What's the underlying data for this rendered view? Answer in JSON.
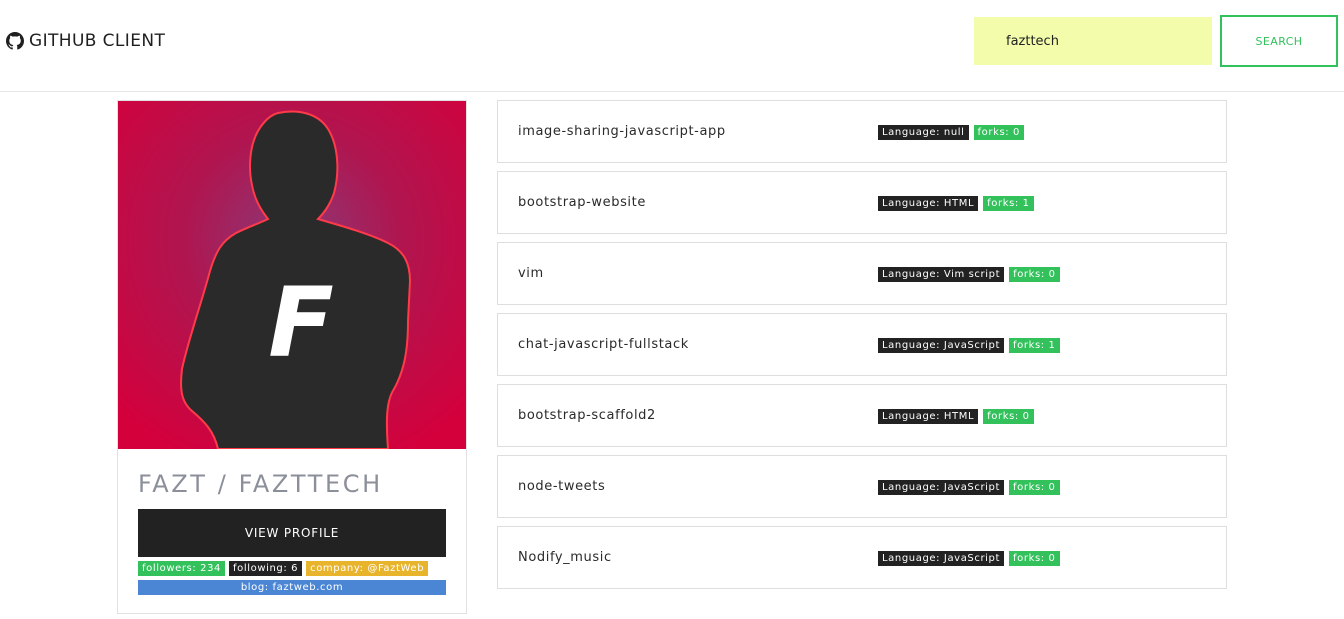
{
  "navbar": {
    "brand_icon": "github-icon",
    "brand_text": "GITHUB CLIENT",
    "search_value": "fazttech",
    "search_button": "SEARCH"
  },
  "colors": {
    "accent_green": "#33c15c",
    "dark": "#222222",
    "yellow": "#e8b42c",
    "blue": "#4a86d4",
    "search_bg": "#f2fcaa",
    "avatar_bg": "#d4003c"
  },
  "profile": {
    "avatar_letter": "F",
    "name": "FAZT / FAZTTECH",
    "view_profile": "VIEW PROFILE",
    "followers": "followers: 234",
    "following": "following: 6",
    "company": "company: @FaztWeb",
    "blog": "blog: faztweb.com"
  },
  "repos": [
    {
      "name": "image-sharing-javascript-app",
      "language": "Language: null",
      "forks": "forks: 0"
    },
    {
      "name": "bootstrap-website",
      "language": "Language: HTML",
      "forks": "forks: 1"
    },
    {
      "name": "vim",
      "language": "Language: Vim script",
      "forks": "forks: 0"
    },
    {
      "name": "chat-javascript-fullstack",
      "language": "Language: JavaScript",
      "forks": "forks: 1"
    },
    {
      "name": "bootstrap-scaffold2",
      "language": "Language: HTML",
      "forks": "forks: 0"
    },
    {
      "name": "node-tweets",
      "language": "Language: JavaScript",
      "forks": "forks: 0"
    },
    {
      "name": "Nodify_music",
      "language": "Language: JavaScript",
      "forks": "forks: 0"
    }
  ]
}
